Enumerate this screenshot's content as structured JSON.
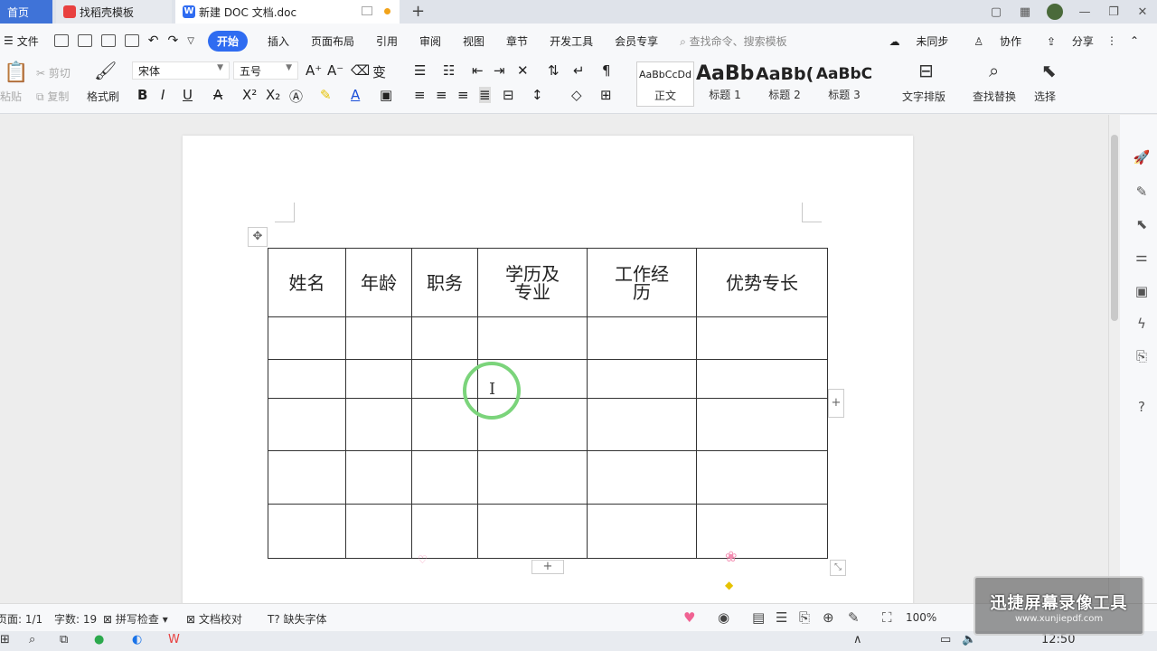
{
  "tabs": {
    "home": "首页",
    "templates": "找稻壳模板",
    "document": "新建 DOC 文档.doc"
  },
  "menu": {
    "file": "文件",
    "items": [
      "开始",
      "插入",
      "页面布局",
      "引用",
      "审阅",
      "视图",
      "章节",
      "开发工具",
      "会员专享"
    ],
    "search_placeholder": "查找命令、搜索模板",
    "sync": "未同步",
    "collab": "协作",
    "share": "分享"
  },
  "ribbon": {
    "paste": "粘贴",
    "cut": "剪切",
    "copy": "复制",
    "format_painter": "格式刷",
    "font_name": "宋体",
    "font_size": "五号",
    "styles": [
      {
        "sample": "AaBbCcDd",
        "label": "正文"
      },
      {
        "sample": "AaBb",
        "label": "标题 1"
      },
      {
        "sample": "AaBb(",
        "label": "标题 2"
      },
      {
        "sample": "AaBbC",
        "label": "标题 3"
      }
    ],
    "text_layout": "文字排版",
    "find_replace": "查找替换",
    "select": "选择"
  },
  "table": {
    "headers": [
      "姓名",
      "年龄",
      "职务",
      "学历及\n专业",
      "工作经\n历",
      "优势专长"
    ],
    "empty_rows": 5
  },
  "status": {
    "page": "页面: 1/1",
    "word_count": "字数: 19",
    "spell_check": "拼写检查",
    "doc_check": "文档校对",
    "missing_fonts": "缺失字体",
    "zoom": "100%"
  },
  "taskbar": {
    "time": "12:50"
  },
  "watermark": {
    "title": "迅捷屏幕录像工具",
    "url": "www.xunjiepdf.com"
  },
  "colors": {
    "accent": "#2f6cf1",
    "home_tab": "#3f73d8",
    "cursor_ring": "#7bd47b"
  }
}
